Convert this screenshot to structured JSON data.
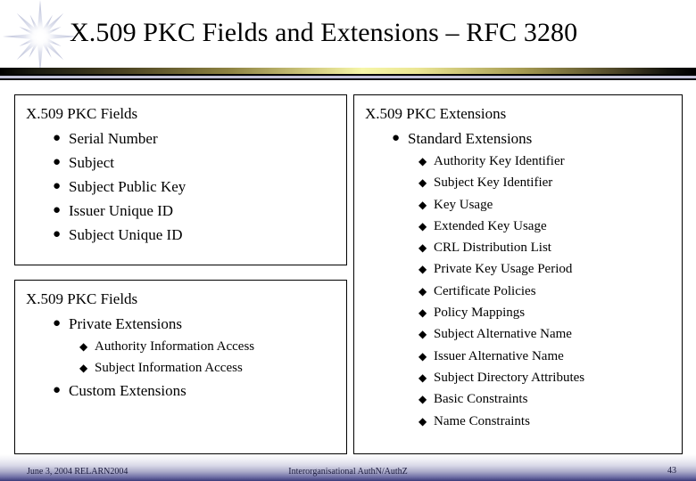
{
  "header": {
    "title": "X.509 PKC Fields and Extensions – RFC 3280",
    "decoration_icon": "starburst-icon"
  },
  "boxes": {
    "fields": {
      "title": "X.509 PKC Fields",
      "items": [
        {
          "label": "Serial Number"
        },
        {
          "label": "Subject"
        },
        {
          "label": "Subject Public Key"
        },
        {
          "label": "Issuer Unique ID"
        },
        {
          "label": "Subject Unique ID"
        }
      ]
    },
    "private": {
      "title": "X.509 PKC Fields",
      "items": [
        {
          "label": "Private Extensions",
          "children": [
            {
              "label": "Authority Information Access"
            },
            {
              "label": "Subject Information Access"
            }
          ]
        },
        {
          "label": "Custom Extensions"
        }
      ]
    },
    "extensions": {
      "title": "X.509 PKC Extensions",
      "items": [
        {
          "label": "Standard Extensions",
          "children": [
            {
              "label": "Authority Key Identifier"
            },
            {
              "label": "Subject Key Identifier"
            },
            {
              "label": "Key Usage"
            },
            {
              "label": "Extended Key Usage"
            },
            {
              "label": "CRL Distribution List"
            },
            {
              "label": "Private Key Usage Period"
            },
            {
              "label": "Certificate Policies"
            },
            {
              "label": "Policy Mappings"
            },
            {
              "label": "Subject Alternative Name"
            },
            {
              "label": "Issuer Alternative Name"
            },
            {
              "label": "Subject Directory Attributes"
            },
            {
              "label": "Basic Constraints"
            },
            {
              "label": "Name Constraints"
            }
          ]
        }
      ]
    }
  },
  "bullets": {
    "level1_glyph": "●",
    "level2_glyph": "◆"
  },
  "footer": {
    "date": "June 3, 2004 RELARN2004",
    "center": "Interorganisational AuthN/AuthZ",
    "page": "43"
  }
}
